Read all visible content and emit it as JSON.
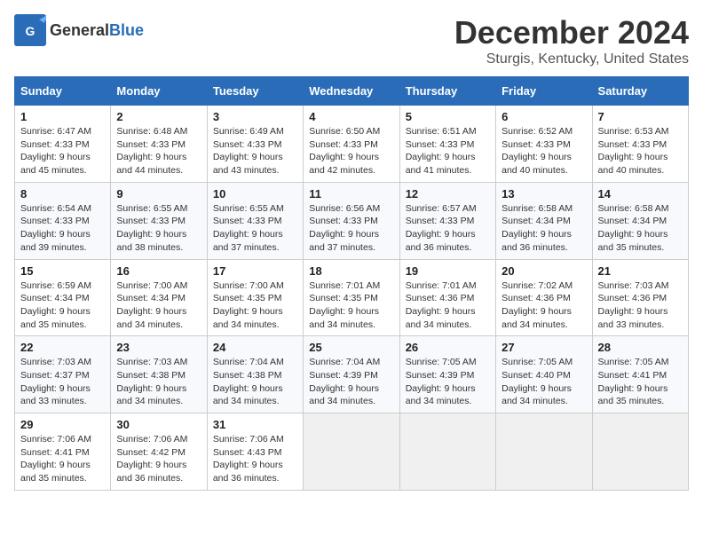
{
  "header": {
    "logo_general": "General",
    "logo_blue": "Blue",
    "title": "December 2024",
    "subtitle": "Sturgis, Kentucky, United States"
  },
  "calendar": {
    "days_of_week": [
      "Sunday",
      "Monday",
      "Tuesday",
      "Wednesday",
      "Thursday",
      "Friday",
      "Saturday"
    ],
    "weeks": [
      [
        {
          "day": "1",
          "info": "Sunrise: 6:47 AM\nSunset: 4:33 PM\nDaylight: 9 hours and 45 minutes."
        },
        {
          "day": "2",
          "info": "Sunrise: 6:48 AM\nSunset: 4:33 PM\nDaylight: 9 hours and 44 minutes."
        },
        {
          "day": "3",
          "info": "Sunrise: 6:49 AM\nSunset: 4:33 PM\nDaylight: 9 hours and 43 minutes."
        },
        {
          "day": "4",
          "info": "Sunrise: 6:50 AM\nSunset: 4:33 PM\nDaylight: 9 hours and 42 minutes."
        },
        {
          "day": "5",
          "info": "Sunrise: 6:51 AM\nSunset: 4:33 PM\nDaylight: 9 hours and 41 minutes."
        },
        {
          "day": "6",
          "info": "Sunrise: 6:52 AM\nSunset: 4:33 PM\nDaylight: 9 hours and 40 minutes."
        },
        {
          "day": "7",
          "info": "Sunrise: 6:53 AM\nSunset: 4:33 PM\nDaylight: 9 hours and 40 minutes."
        }
      ],
      [
        {
          "day": "8",
          "info": "Sunrise: 6:54 AM\nSunset: 4:33 PM\nDaylight: 9 hours and 39 minutes."
        },
        {
          "day": "9",
          "info": "Sunrise: 6:55 AM\nSunset: 4:33 PM\nDaylight: 9 hours and 38 minutes."
        },
        {
          "day": "10",
          "info": "Sunrise: 6:55 AM\nSunset: 4:33 PM\nDaylight: 9 hours and 37 minutes."
        },
        {
          "day": "11",
          "info": "Sunrise: 6:56 AM\nSunset: 4:33 PM\nDaylight: 9 hours and 37 minutes."
        },
        {
          "day": "12",
          "info": "Sunrise: 6:57 AM\nSunset: 4:33 PM\nDaylight: 9 hours and 36 minutes."
        },
        {
          "day": "13",
          "info": "Sunrise: 6:58 AM\nSunset: 4:34 PM\nDaylight: 9 hours and 36 minutes."
        },
        {
          "day": "14",
          "info": "Sunrise: 6:58 AM\nSunset: 4:34 PM\nDaylight: 9 hours and 35 minutes."
        }
      ],
      [
        {
          "day": "15",
          "info": "Sunrise: 6:59 AM\nSunset: 4:34 PM\nDaylight: 9 hours and 35 minutes."
        },
        {
          "day": "16",
          "info": "Sunrise: 7:00 AM\nSunset: 4:34 PM\nDaylight: 9 hours and 34 minutes."
        },
        {
          "day": "17",
          "info": "Sunrise: 7:00 AM\nSunset: 4:35 PM\nDaylight: 9 hours and 34 minutes."
        },
        {
          "day": "18",
          "info": "Sunrise: 7:01 AM\nSunset: 4:35 PM\nDaylight: 9 hours and 34 minutes."
        },
        {
          "day": "19",
          "info": "Sunrise: 7:01 AM\nSunset: 4:36 PM\nDaylight: 9 hours and 34 minutes."
        },
        {
          "day": "20",
          "info": "Sunrise: 7:02 AM\nSunset: 4:36 PM\nDaylight: 9 hours and 34 minutes."
        },
        {
          "day": "21",
          "info": "Sunrise: 7:03 AM\nSunset: 4:36 PM\nDaylight: 9 hours and 33 minutes."
        }
      ],
      [
        {
          "day": "22",
          "info": "Sunrise: 7:03 AM\nSunset: 4:37 PM\nDaylight: 9 hours and 33 minutes."
        },
        {
          "day": "23",
          "info": "Sunrise: 7:03 AM\nSunset: 4:38 PM\nDaylight: 9 hours and 34 minutes."
        },
        {
          "day": "24",
          "info": "Sunrise: 7:04 AM\nSunset: 4:38 PM\nDaylight: 9 hours and 34 minutes."
        },
        {
          "day": "25",
          "info": "Sunrise: 7:04 AM\nSunset: 4:39 PM\nDaylight: 9 hours and 34 minutes."
        },
        {
          "day": "26",
          "info": "Sunrise: 7:05 AM\nSunset: 4:39 PM\nDaylight: 9 hours and 34 minutes."
        },
        {
          "day": "27",
          "info": "Sunrise: 7:05 AM\nSunset: 4:40 PM\nDaylight: 9 hours and 34 minutes."
        },
        {
          "day": "28",
          "info": "Sunrise: 7:05 AM\nSunset: 4:41 PM\nDaylight: 9 hours and 35 minutes."
        }
      ],
      [
        {
          "day": "29",
          "info": "Sunrise: 7:06 AM\nSunset: 4:41 PM\nDaylight: 9 hours and 35 minutes."
        },
        {
          "day": "30",
          "info": "Sunrise: 7:06 AM\nSunset: 4:42 PM\nDaylight: 9 hours and 36 minutes."
        },
        {
          "day": "31",
          "info": "Sunrise: 7:06 AM\nSunset: 4:43 PM\nDaylight: 9 hours and 36 minutes."
        },
        {
          "day": "",
          "info": ""
        },
        {
          "day": "",
          "info": ""
        },
        {
          "day": "",
          "info": ""
        },
        {
          "day": "",
          "info": ""
        }
      ]
    ]
  }
}
